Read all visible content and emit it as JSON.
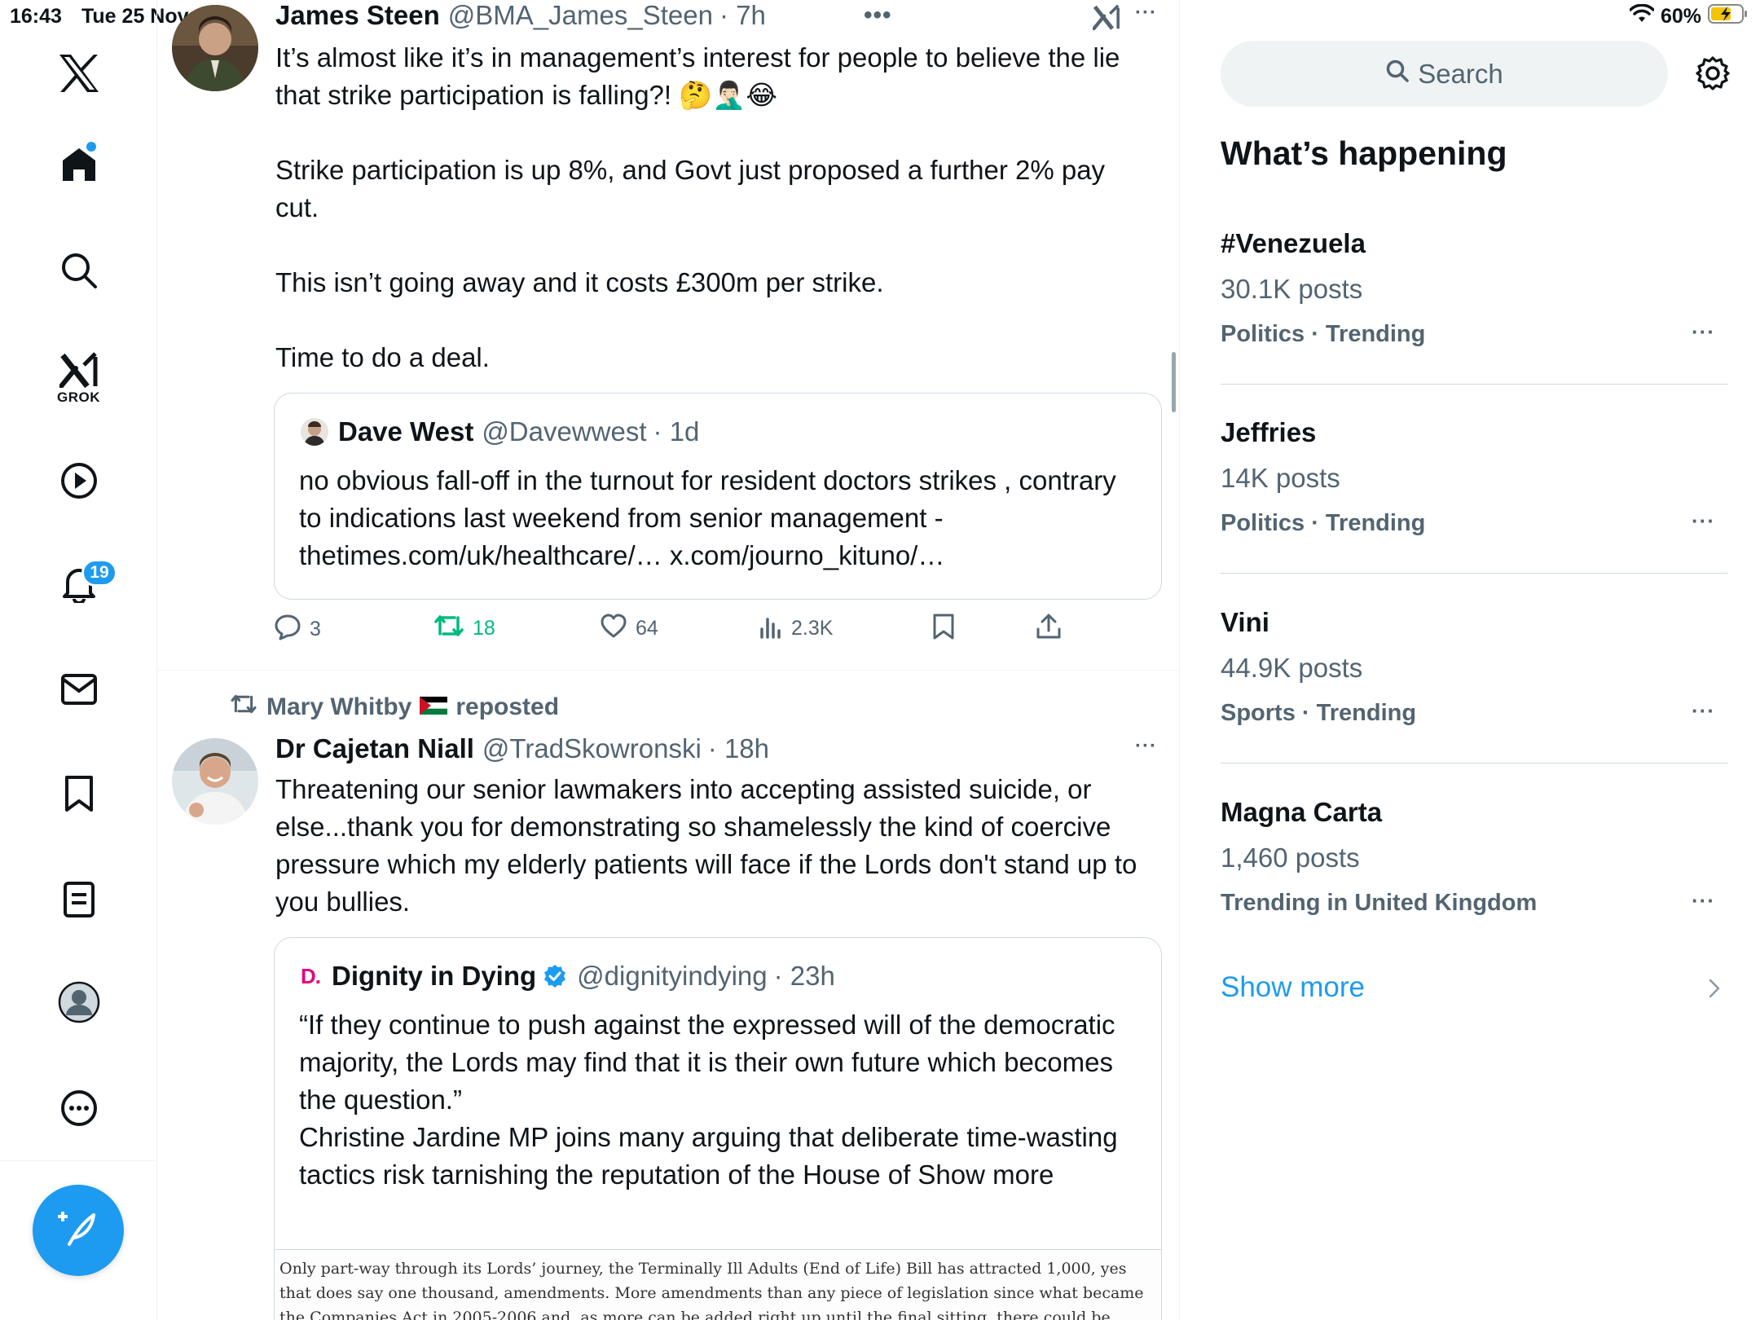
{
  "status_bar": {
    "time": "16:43",
    "date": "Tue 25 Nov",
    "battery": "60%"
  },
  "nav": {
    "grok_label": "GROK",
    "notifications_count": "19",
    "icons": [
      "x-logo-icon",
      "home-icon",
      "search-icon",
      "grok-icon",
      "video-icon",
      "bell-icon",
      "mail-icon",
      "bookmark-icon",
      "lists-icon",
      "profile-icon",
      "more-icon",
      "compose-icon"
    ]
  },
  "tweets": [
    {
      "name": "James Steen",
      "handle": "@BMA_James_Steen",
      "time": "· 7h",
      "paragraphs": [
        "It’s almost like it’s in management’s interest for people to believe the lie that strike participation is falling?! 🤔🤦🏻‍♂️😂",
        "Strike participation is up 8%, and Govt just proposed a further 2% pay cut.",
        "This isn’t going away and it costs £300m per strike.",
        "Time to do a deal."
      ],
      "quote": {
        "name": "Dave West",
        "handle": "@Davewwest",
        "time": "· 1d",
        "text": "no obvious fall-off in the turnout for resident doctors strikes , contrary to indications last weekend from senior management - thetimes.com/uk/healthcare/… x.com/journo_kituno/…"
      },
      "actions": {
        "replies": "3",
        "reposts": "18",
        "likes": "64",
        "views": "2.3K"
      }
    },
    {
      "reposted_by": "Mary Whitby",
      "reposted_label": "reposted",
      "name": "Dr Cajetan Niall",
      "handle": "@TradSkowronski",
      "time": "· 18h",
      "text": "Threatening our senior lawmakers into accepting assisted suicide, or else...thank you for demonstrating so shamelessly the kind of coercive pressure which my elderly patients will face if the Lords don't stand up to you bullies.",
      "quote": {
        "logo_letter": "D.",
        "name": "Dignity in Dying",
        "handle": "@dignityindying",
        "time": "· 23h",
        "text_lines": [
          "“If they continue to push against the expressed will of the democratic majority, the Lords may find that it is their own future which becomes the question.”",
          "Christine Jardine MP joins many arguing that deliberate time-wasting tactics risk tarnishing the reputation of the House of Show more"
        ],
        "article_excerpt": "Only part-way through its Lords’ journey, the Terminally Ill Adults (End of Life) Bill has attracted 1,000, yes that does say one thousand, amendments. More amendments than any piece of legislation since what became the Companies Act in 2005-2006 and, as more can be added right up until the final sitting, there could be more."
      }
    }
  ],
  "sidebar": {
    "search_placeholder": "Search",
    "heading": "What’s happening",
    "trends": [
      {
        "name": "#Venezuela",
        "count": "30.1K posts",
        "category": "Politics · Trending"
      },
      {
        "name": "Jeffries",
        "count": "14K posts",
        "category": "Politics · Trending"
      },
      {
        "name": "Vini",
        "count": "44.9K posts",
        "category": "Sports · Trending"
      },
      {
        "name": "Magna Carta",
        "count": "1,460 posts",
        "category": "Trending in United Kingdom"
      }
    ],
    "show_more": "Show more"
  },
  "colors": {
    "accent": "#1d9bf0",
    "retweet_green": "#00ba7c",
    "secondary_text": "#536471",
    "dignity_pink": "#e6007e"
  }
}
